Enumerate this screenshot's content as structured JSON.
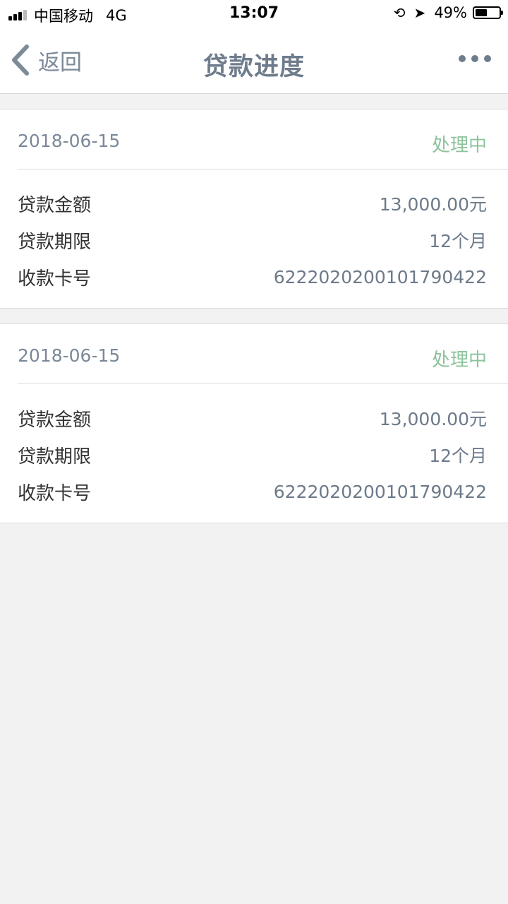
{
  "status_bar": {
    "carrier": "中国移动",
    "network": "4G",
    "time": "13:07",
    "battery": "49%",
    "battery_level": 0.49
  },
  "nav": {
    "back_label": "返回",
    "title": "贷款进度"
  },
  "loans": [
    {
      "date": "2018-06-15",
      "status": "处理中",
      "rows": [
        {
          "label": "贷款金额",
          "value": "13,000.00元"
        },
        {
          "label": "贷款期限",
          "value": "12个月"
        },
        {
          "label": "收款卡号",
          "value": "6222020200101790422"
        }
      ]
    },
    {
      "date": "2018-06-15",
      "status": "处理中",
      "rows": [
        {
          "label": "贷款金额",
          "value": "13,000.00元"
        },
        {
          "label": "贷款期限",
          "value": "12个月"
        },
        {
          "label": "收款卡号",
          "value": "6222020200101790422"
        }
      ]
    }
  ],
  "colors": {
    "status_green": "#8cc39b",
    "nav_gray": "#6e7c8c"
  }
}
